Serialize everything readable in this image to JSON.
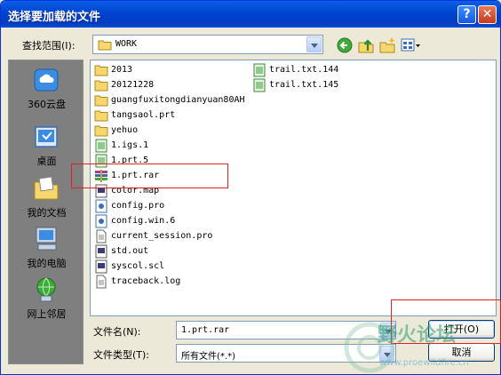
{
  "window": {
    "title": "选择要加载的文件"
  },
  "toolbar": {
    "lookin_label": "查找范围(I):",
    "lookin_value": "WORK"
  },
  "places": [
    {
      "label": "360云盘",
      "icon": "cloud-drive-icon"
    },
    {
      "label": "桌面",
      "icon": "desktop-icon"
    },
    {
      "label": "我的文档",
      "icon": "my-documents-icon"
    },
    {
      "label": "我的电脑",
      "icon": "my-computer-icon"
    },
    {
      "label": "网上邻居",
      "icon": "network-places-icon"
    }
  ],
  "files_col1": [
    {
      "name": "2013",
      "type": "folder"
    },
    {
      "name": "20121228",
      "type": "folder"
    },
    {
      "name": "guangfuxitongdianyuan80AH",
      "type": "folder"
    },
    {
      "name": "tangsaol.prt",
      "type": "folder"
    },
    {
      "name": "yehuo",
      "type": "folder"
    },
    {
      "name": "1.igs.1",
      "type": "model"
    },
    {
      "name": "1.prt.5",
      "type": "model"
    },
    {
      "name": "1.prt.rar",
      "type": "archive"
    },
    {
      "name": "color.map",
      "type": "sys"
    },
    {
      "name": "config.pro",
      "type": "config"
    },
    {
      "name": "config.win.6",
      "type": "config"
    },
    {
      "name": "current_session.pro",
      "type": "text"
    },
    {
      "name": "std.out",
      "type": "sys"
    },
    {
      "name": "syscol.scl",
      "type": "sys"
    },
    {
      "name": "traceback.log",
      "type": "text"
    }
  ],
  "files_col2": [
    {
      "name": "trail.txt.144",
      "type": "model"
    },
    {
      "name": "trail.txt.145",
      "type": "model"
    }
  ],
  "footer": {
    "filename_label": "文件名(N):",
    "filename_value": "1.prt.rar",
    "filetype_label": "文件类型(T):",
    "filetype_value": "所有文件(*.*)",
    "open_label": "打开(O)",
    "cancel_label": "取消"
  },
  "watermark": {
    "text": "野火论坛",
    "url": "www.proewildfire.cn"
  }
}
